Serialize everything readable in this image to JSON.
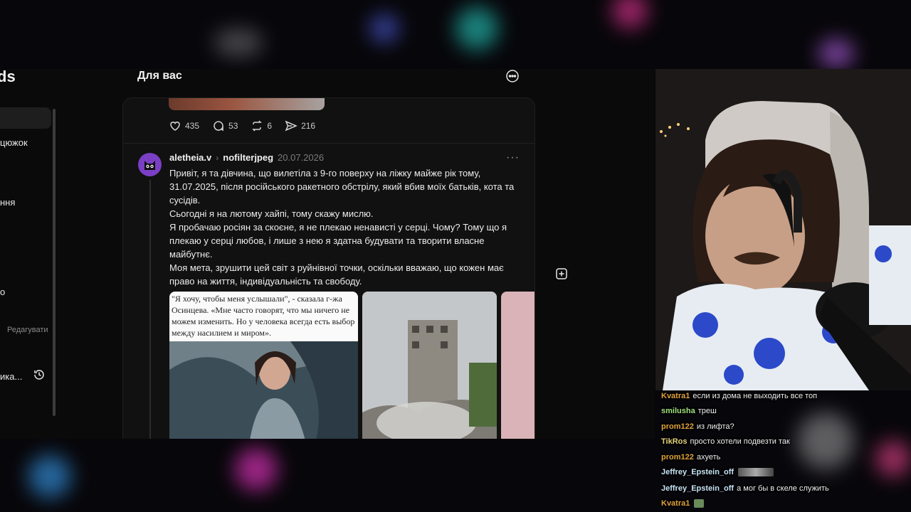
{
  "app": {
    "logo": "ds",
    "sidebar": {
      "items": [
        {
          "label": "цюжок"
        },
        {
          "label": "ння"
        },
        {
          "label": "о"
        },
        {
          "label": "ика..."
        }
      ],
      "edit_label": "Редагувати"
    },
    "feed": {
      "title": "Для вас",
      "prev_post": {
        "likes": "435",
        "comments": "53",
        "reposts": "6",
        "shares": "216"
      },
      "post": {
        "username": "aletheia.v",
        "reply_to": "nofilterjpeg",
        "date": "20.07.2026",
        "paragraphs": [
          "Привіт, я та дівчина, що вилетіла з 9-го поверху на ліжку майже рік тому, 31.07.2025, після російського ракетного обстрілу, який вбив моїх батьків, кота та сусідів.",
          "Сьогодні я на лютому хайпі, тому скажу мислю.",
          "Я пробачаю росіян за скоєне, я не плекаю ненависті у серці. Чому? Тому що я плекаю у серці любов, і лише з нею я здатна будувати та творити власне майбутнє.",
          "Моя мета, зрушити цей світ з руйнівної точки, оскільки вважаю, що кожен має право на життя, індивідуальність та свободу."
        ],
        "image_caption": "\"Я хочу, чтобы меня услышали\", - сказала г-жа Осинцева. «Мне часто говорят, что мы ничего не можем изменить. Но у человека всегда есть выбор между насилием и миром»."
      }
    }
  },
  "chat": {
    "messages": [
      {
        "user": "Kvatra1",
        "color": "#e0a33a",
        "text": "если из дома не выходить все топ"
      },
      {
        "user": "smilusha",
        "color": "#9fe07a",
        "text": "треш"
      },
      {
        "user": "prom122",
        "color": "#e0a33a",
        "text": "из лифта?"
      },
      {
        "user": "TikRos",
        "color": "#e4d27a",
        "text": "просто хотели подвезти так"
      },
      {
        "user": "prom122",
        "color": "#e0a33a",
        "text": "ахуеть"
      },
      {
        "user": "Jeffrey_Epstein_off",
        "color": "#c7e3f5",
        "text": ""
      },
      {
        "user": "Jeffrey_Epstein_off",
        "color": "#c7e3f5",
        "text": "а мог бы в скеле служить"
      },
      {
        "user": "Kvatra1",
        "color": "#e0a33a",
        "text": ""
      }
    ]
  }
}
